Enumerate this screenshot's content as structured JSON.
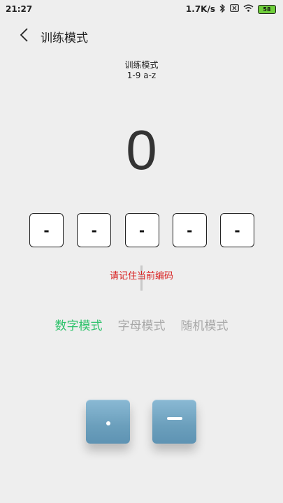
{
  "status_bar": {
    "time": "21:27",
    "network_speed": "1.7K/s",
    "battery_level": "58",
    "icons": [
      "bluetooth-icon",
      "sim-off-icon",
      "wifi-icon",
      "battery-icon"
    ]
  },
  "header": {
    "title": "训练模式",
    "back_icon": "chevron-left-icon"
  },
  "subtitle": {
    "line1": "训练模式",
    "line2": "1-9  a-z"
  },
  "current_char": "0",
  "slots": [
    "-",
    "-",
    "-",
    "-",
    "-"
  ],
  "hint": "请记住当前编码",
  "modes": [
    {
      "label": "数字模式",
      "active": true
    },
    {
      "label": "字母模式",
      "active": false
    },
    {
      "label": "随机模式",
      "active": false
    }
  ],
  "keys": {
    "dot_icon": "dot-icon",
    "dash_icon": "dash-icon"
  },
  "colors": {
    "background": "#eeeeee",
    "accent_active": "#2ec26b",
    "inactive": "#a8a8a8",
    "hint_red": "#d81e1e",
    "key_blue": "#6b9fbc"
  }
}
